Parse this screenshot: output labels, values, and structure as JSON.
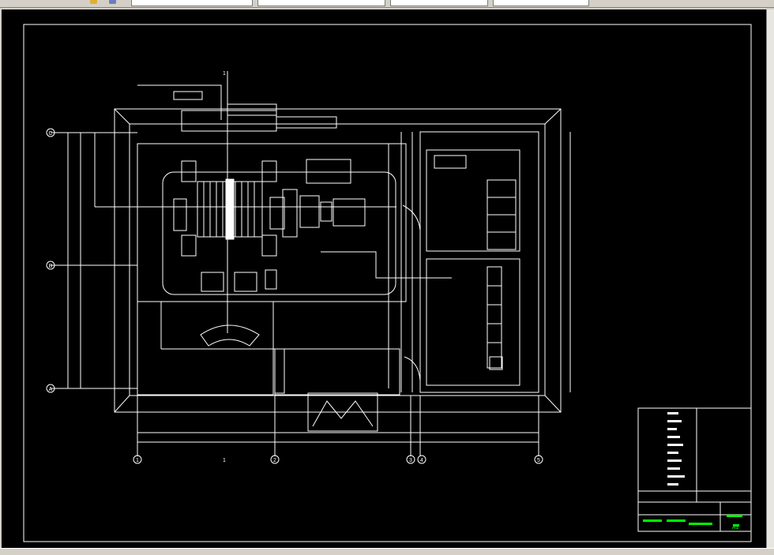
{
  "drawing": {
    "grid_axes": [
      "C",
      "B",
      "A"
    ],
    "grid_axes_bottom": [
      "1",
      "2",
      "3",
      "4",
      "5"
    ],
    "section_mark": "1",
    "bottom_mark": "1",
    "scale_label": "A1"
  },
  "colors": {
    "background": "#000000",
    "lines": "#ffffff",
    "accent": "#00ff00",
    "chrome": "#d4d0c8"
  }
}
